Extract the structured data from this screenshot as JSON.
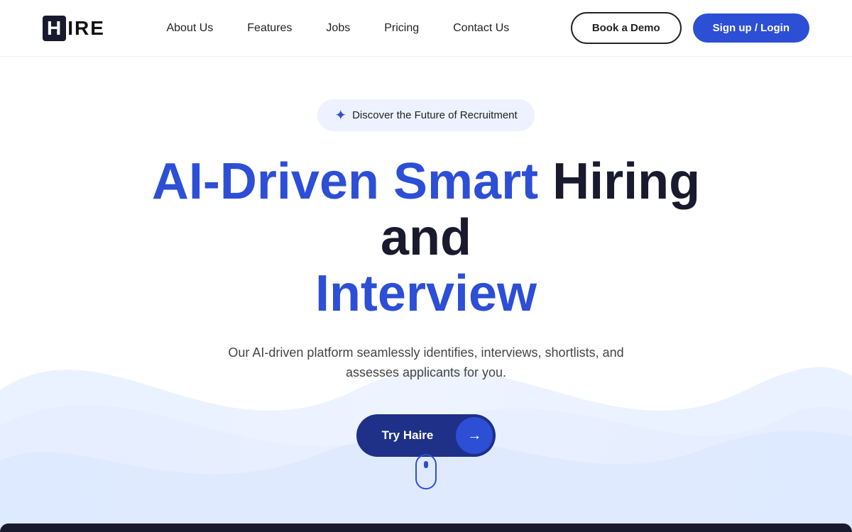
{
  "logo": {
    "box_text": "H",
    "rest_text": "IRE"
  },
  "nav": {
    "links": [
      {
        "label": "About Us",
        "id": "about-us"
      },
      {
        "label": "Features",
        "id": "features"
      },
      {
        "label": "Jobs",
        "id": "jobs"
      },
      {
        "label": "Pricing",
        "id": "pricing"
      },
      {
        "label": "Contact Us",
        "id": "contact-us"
      }
    ],
    "book_demo_label": "Book a Demo",
    "signup_label": "Sign up / Login"
  },
  "hero": {
    "badge_text": "Discover the Future of Recruitment",
    "title_line1": "AI-Driven Smart Hiring and",
    "title_line2": "Interview",
    "subtitle": "Our AI-driven platform seamlessly identifies, interviews, shortlists, and assesses applicants for you.",
    "cta_label": "Try Haire"
  }
}
